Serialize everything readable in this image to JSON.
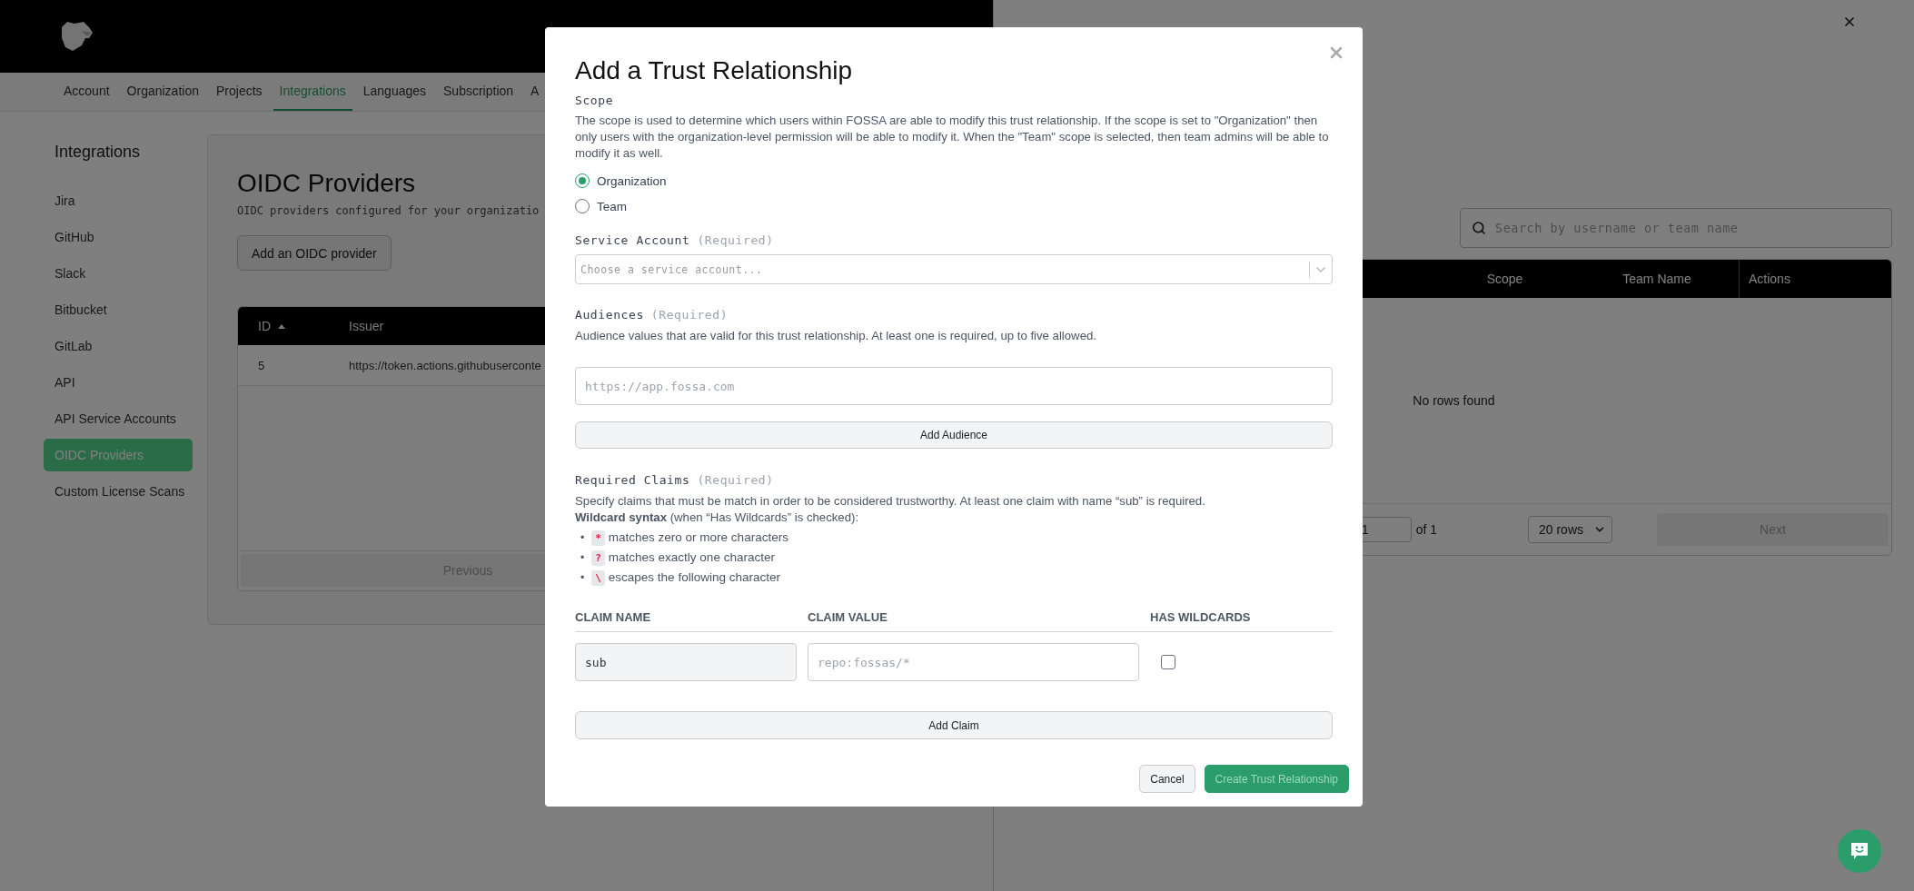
{
  "nav": {
    "tabs": [
      {
        "label": "Account",
        "selected": false
      },
      {
        "label": "Organization",
        "selected": false
      },
      {
        "label": "Projects",
        "selected": false
      },
      {
        "label": "Integrations",
        "selected": true
      },
      {
        "label": "Languages",
        "selected": false
      },
      {
        "label": "Subscription",
        "selected": false
      },
      {
        "label": "A",
        "selected": false
      }
    ]
  },
  "sidebar": {
    "title": "Integrations",
    "items": [
      {
        "label": "Jira",
        "selected": false
      },
      {
        "label": "GitHub",
        "selected": false
      },
      {
        "label": "Slack",
        "selected": false
      },
      {
        "label": "Bitbucket",
        "selected": false
      },
      {
        "label": "GitLab",
        "selected": false
      },
      {
        "label": "API",
        "selected": false
      },
      {
        "label": "API Service Accounts",
        "selected": false
      },
      {
        "label": "OIDC Providers",
        "selected": true
      },
      {
        "label": "Custom License Scans",
        "selected": false
      }
    ]
  },
  "page": {
    "title": "OIDC Providers",
    "subtitle": "OIDC providers configured for your organizatio",
    "add_button": "Add an OIDC provider",
    "table": {
      "columns": [
        {
          "label": "ID",
          "sorted": true
        },
        {
          "label": "Issuer",
          "sorted": false
        }
      ],
      "rows": [
        [
          "5",
          "https://token.actions.githubuserconte"
        ]
      ],
      "previous_button": "Previous"
    }
  },
  "drawer": {
    "search": {
      "placeholder": "Search by username or team name"
    },
    "table": {
      "columns": [
        "Scope",
        "Team Name",
        "Actions"
      ],
      "empty_message": "No rows found"
    },
    "pagination": {
      "page": "1",
      "total": "of 1",
      "rows_per_page": "20 rows",
      "next_button": "Next"
    }
  },
  "modal": {
    "title": "Add a Trust Relationship",
    "scope": {
      "label": "Scope",
      "description": "The scope is used to determine which users within FOSSA are able to modify this trust relationship. If the scope is set to \"Organization\" then only users with the organization-level permission will be able to modify it. When the \"Team\" scope is selected, then team admins will be able to modify it as well.",
      "options": [
        {
          "label": "Organization",
          "selected": true
        },
        {
          "label": "Team",
          "selected": false
        }
      ]
    },
    "service_account": {
      "label": "Service Account",
      "note": "(Required)",
      "placeholder": "Choose a service account..."
    },
    "audiences": {
      "label": "Audiences",
      "note": "(Required)",
      "description": "Audience values that are valid for this trust relationship. At least one is required, up to five allowed.",
      "placeholder": "https://app.fossa.com",
      "add_button": "Add Audience"
    },
    "required_claims": {
      "label": "Required Claims",
      "note": "(Required)",
      "description": "Specify claims that must be match in order to be considered trustworthy. At least one claim with name “sub” is required.",
      "wildcard_intro": "**Wildcard syntax** (when “Has Wildcards” is checked):",
      "syntax": [
        {
          "marker": "•",
          "symbol": "*",
          "text": "matches zero or more characters"
        },
        {
          "marker": "•",
          "symbol": "?",
          "text": "matches exactly one character"
        },
        {
          "marker": "•",
          "symbol": "\\",
          "text": "escapes the following character"
        }
      ],
      "columns": [
        "CLAIM NAME",
        "CLAIM VALUE",
        "HAS WILDCARDS"
      ],
      "claims": [
        {
          "name": "sub",
          "name_locked": true,
          "value_placeholder": "repo:fossas/*",
          "has_wildcards": false
        }
      ],
      "add_button": "Add Claim"
    },
    "buttons": [
      {
        "label": "Cancel",
        "kind": "secondary",
        "disabled": false
      },
      {
        "label": "Create Trust Relationship",
        "kind": "primary",
        "disabled": true
      }
    ]
  }
}
